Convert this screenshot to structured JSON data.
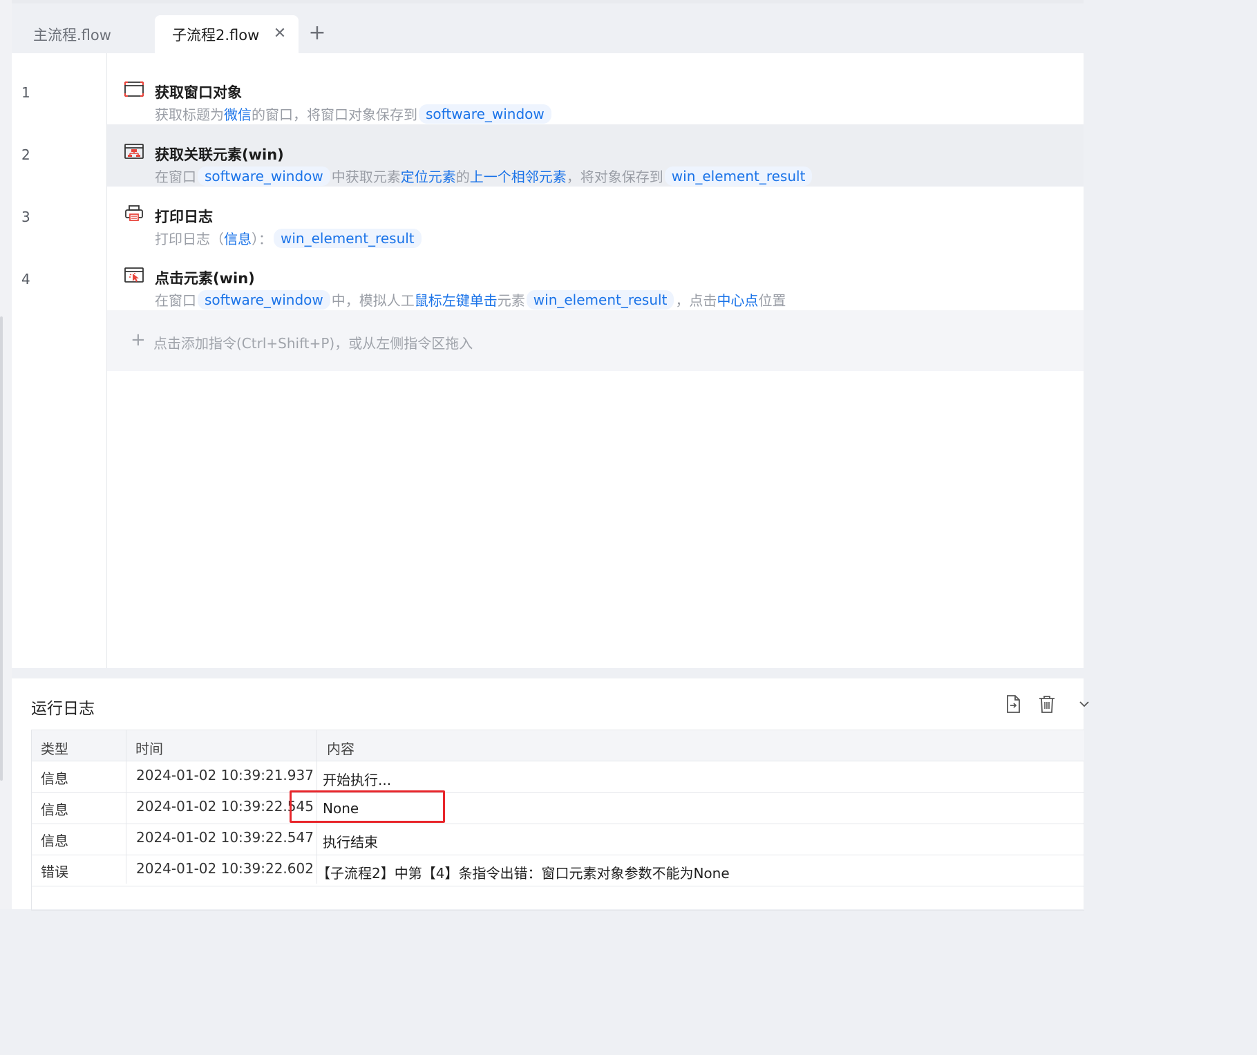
{
  "tabs": [
    {
      "label": "主流程.flow",
      "active": false
    },
    {
      "label": "子流程2.flow",
      "active": true
    }
  ],
  "tab_close_icon": "close-icon",
  "tab_add_icon": "plus-icon",
  "line_numbers": [
    "1",
    "2",
    "3",
    "4"
  ],
  "instructions": [
    {
      "icon": "window-icon",
      "title": "获取窗口对象",
      "desc": [
        {
          "t": "text",
          "v": "获取标题为"
        },
        {
          "t": "kw",
          "v": "微信"
        },
        {
          "t": "text",
          "v": "的窗口，将窗口对象保存到"
        },
        {
          "t": "chip",
          "v": "software_window"
        }
      ]
    },
    {
      "icon": "element-tree-icon",
      "title": "获取关联元素(win)",
      "selected": true,
      "desc": [
        {
          "t": "text",
          "v": "在窗口"
        },
        {
          "t": "chip",
          "v": "software_window"
        },
        {
          "t": "text",
          "v": "中获取元素"
        },
        {
          "t": "kw",
          "v": "定位元素"
        },
        {
          "t": "text",
          "v": "的"
        },
        {
          "t": "kw",
          "v": "上一个相邻元素"
        },
        {
          "t": "text",
          "v": "，将对象保存到"
        },
        {
          "t": "chip",
          "v": "win_element_result"
        }
      ]
    },
    {
      "icon": "printer-icon",
      "title": "打印日志",
      "desc": [
        {
          "t": "text",
          "v": "打印日志（"
        },
        {
          "t": "kw",
          "v": "信息"
        },
        {
          "t": "text",
          "v": "）："
        },
        {
          "t": "chip",
          "v": "win_element_result"
        }
      ]
    },
    {
      "icon": "click-element-icon",
      "title": "点击元素(win)",
      "desc": [
        {
          "t": "text",
          "v": "在窗口"
        },
        {
          "t": "chip",
          "v": "software_window"
        },
        {
          "t": "text",
          "v": "中，模拟人工"
        },
        {
          "t": "kw",
          "v": "鼠标左键单击"
        },
        {
          "t": "text",
          "v": "元素"
        },
        {
          "t": "chip",
          "v": "win_element_result"
        },
        {
          "t": "text",
          "v": "，点击"
        },
        {
          "t": "kw",
          "v": "中心点"
        },
        {
          "t": "text",
          "v": "位置"
        }
      ]
    }
  ],
  "add_instruction": "点击添加指令(Ctrl+Shift+P)，或从左侧指令区拖入",
  "log": {
    "title": "运行日志",
    "export_icon": "export-file-icon",
    "clear_icon": "trash-icon",
    "columns": [
      "类型",
      "时间",
      "内容"
    ],
    "rows": [
      {
        "type": "信息",
        "time": "2024-01-02 10:39:21.937",
        "content": "开始执行..."
      },
      {
        "type": "信息",
        "time": "2024-01-02 10:39:22.545",
        "content": "None"
      },
      {
        "type": "信息",
        "time": "2024-01-02 10:39:22.547",
        "content": "执行结束"
      },
      {
        "type": "错误",
        "time": "2024-01-02 10:39:22.602",
        "content": "【子流程2】中第【4】条指令出错：窗口元素对象参数不能为None"
      }
    ]
  },
  "colors": {
    "accent": "#1a73e8",
    "highlight_box": "#e8262b",
    "muted_text": "#9a9ea6",
    "selected_row": "#eceef2"
  }
}
